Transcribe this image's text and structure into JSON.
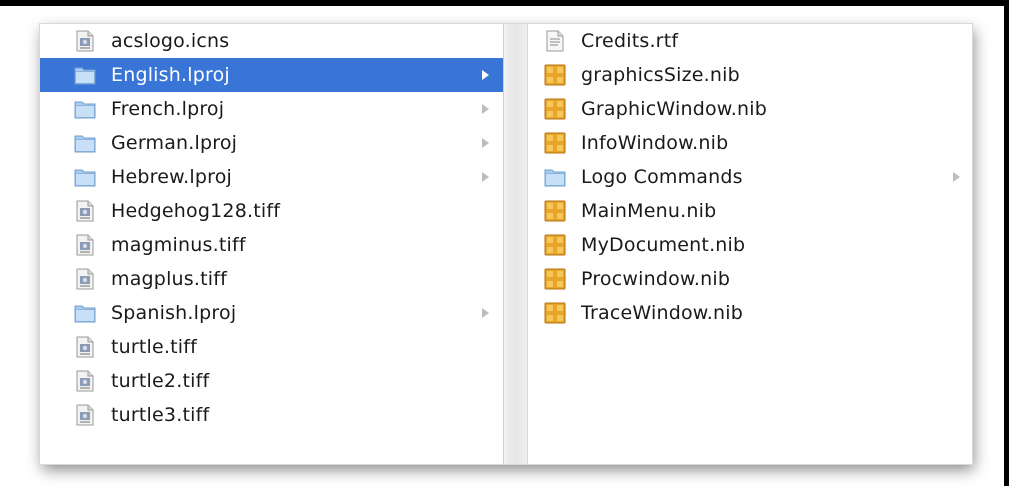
{
  "column1": {
    "items": [
      {
        "label": "acslogo.icns",
        "kind": "file",
        "icon": "document-icon",
        "selected": false,
        "has_children": false
      },
      {
        "label": "English.lproj",
        "kind": "folder",
        "icon": "folder-icon",
        "selected": true,
        "has_children": true
      },
      {
        "label": "French.lproj",
        "kind": "folder",
        "icon": "folder-icon",
        "selected": false,
        "has_children": true
      },
      {
        "label": "German.lproj",
        "kind": "folder",
        "icon": "folder-icon",
        "selected": false,
        "has_children": true
      },
      {
        "label": "Hebrew.lproj",
        "kind": "folder",
        "icon": "folder-icon",
        "selected": false,
        "has_children": true
      },
      {
        "label": "Hedgehog128.tiff",
        "kind": "file",
        "icon": "document-icon",
        "selected": false,
        "has_children": false
      },
      {
        "label": "magminus.tiff",
        "kind": "file",
        "icon": "document-icon",
        "selected": false,
        "has_children": false
      },
      {
        "label": "magplus.tiff",
        "kind": "file",
        "icon": "document-icon",
        "selected": false,
        "has_children": false
      },
      {
        "label": "Spanish.lproj",
        "kind": "folder",
        "icon": "folder-icon",
        "selected": false,
        "has_children": true
      },
      {
        "label": "turtle.tiff",
        "kind": "file",
        "icon": "document-icon",
        "selected": false,
        "has_children": false
      },
      {
        "label": "turtle2.tiff",
        "kind": "file",
        "icon": "document-icon",
        "selected": false,
        "has_children": false
      },
      {
        "label": "turtle3.tiff",
        "kind": "file",
        "icon": "document-icon",
        "selected": false,
        "has_children": false
      }
    ]
  },
  "column2": {
    "items": [
      {
        "label": "Credits.rtf",
        "kind": "rtf",
        "icon": "rtf-document-icon",
        "selected": false,
        "has_children": false
      },
      {
        "label": "graphicsSize.nib",
        "kind": "nib",
        "icon": "nib-file-icon",
        "selected": false,
        "has_children": false
      },
      {
        "label": "GraphicWindow.nib",
        "kind": "nib",
        "icon": "nib-file-icon",
        "selected": false,
        "has_children": false
      },
      {
        "label": "InfoWindow.nib",
        "kind": "nib",
        "icon": "nib-file-icon",
        "selected": false,
        "has_children": false
      },
      {
        "label": "Logo Commands",
        "kind": "folder",
        "icon": "folder-icon",
        "selected": false,
        "has_children": true
      },
      {
        "label": "MainMenu.nib",
        "kind": "nib",
        "icon": "nib-file-icon",
        "selected": false,
        "has_children": false
      },
      {
        "label": "MyDocument.nib",
        "kind": "nib",
        "icon": "nib-file-icon",
        "selected": false,
        "has_children": false
      },
      {
        "label": "Procwindow.nib",
        "kind": "nib",
        "icon": "nib-file-icon",
        "selected": false,
        "has_children": false
      },
      {
        "label": "TraceWindow.nib",
        "kind": "nib",
        "icon": "nib-file-icon",
        "selected": false,
        "has_children": false
      }
    ]
  },
  "colors": {
    "selection": "#3875d7",
    "folder": "#a9cdf2",
    "nib": "#e8a52a",
    "disclosure_arrow": "#bdbdbd"
  }
}
